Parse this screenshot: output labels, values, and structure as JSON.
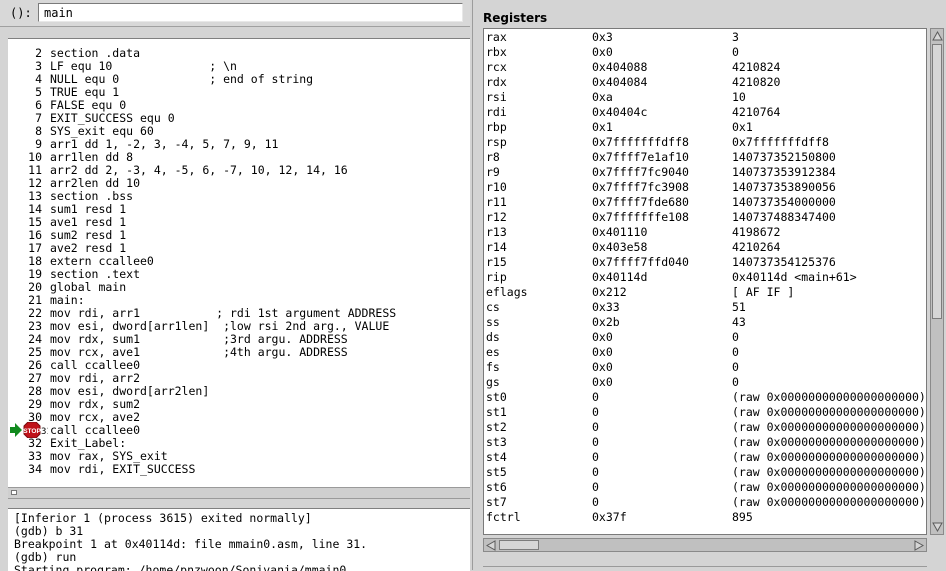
{
  "expression_bar": {
    "label": "():",
    "value": "main"
  },
  "source": {
    "breakpoint_marker": "STOP",
    "lines": [
      {
        "num": "2",
        "code": "section .data"
      },
      {
        "num": "3",
        "code": "LF equ 10              ; \\n"
      },
      {
        "num": "4",
        "code": "NULL equ 0             ; end of string"
      },
      {
        "num": "5",
        "code": "TRUE equ 1"
      },
      {
        "num": "6",
        "code": "FALSE equ 0"
      },
      {
        "num": "7",
        "code": "EXIT_SUCCESS equ 0"
      },
      {
        "num": "8",
        "code": "SYS_exit equ 60"
      },
      {
        "num": "9",
        "code": "arr1 dd 1, -2, 3, -4, 5, 7, 9, 11"
      },
      {
        "num": "10",
        "code": "arr1len dd 8"
      },
      {
        "num": "11",
        "code": "arr2 dd 2, -3, 4, -5, 6, -7, 10, 12, 14, 16"
      },
      {
        "num": "12",
        "code": "arr2len dd 10"
      },
      {
        "num": "13",
        "code": "section .bss"
      },
      {
        "num": "14",
        "code": "sum1 resd 1"
      },
      {
        "num": "15",
        "code": "ave1 resd 1"
      },
      {
        "num": "16",
        "code": "sum2 resd 1"
      },
      {
        "num": "17",
        "code": "ave2 resd 1"
      },
      {
        "num": "18",
        "code": "extern ccallee0"
      },
      {
        "num": "19",
        "code": "section .text"
      },
      {
        "num": "20",
        "code": "global main"
      },
      {
        "num": "21",
        "code": "main:"
      },
      {
        "num": "22",
        "code": "mov rdi, arr1           ; rdi 1st argument ADDRESS"
      },
      {
        "num": "23",
        "code": "mov esi, dword[arr1len]  ;low rsi 2nd arg., VALUE"
      },
      {
        "num": "24",
        "code": "mov rdx, sum1            ;3rd argu. ADDRESS"
      },
      {
        "num": "25",
        "code": "mov rcx, ave1            ;4th argu. ADDRESS"
      },
      {
        "num": "26",
        "code": "call ccallee0"
      },
      {
        "num": "27",
        "code": "mov rdi, arr2"
      },
      {
        "num": "28",
        "code": "mov esi, dword[arr2len]"
      },
      {
        "num": "29",
        "code": "mov rdx, sum2"
      },
      {
        "num": "30",
        "code": "mov rcx, ave2"
      },
      {
        "num": "31",
        "code": "call ccallee0"
      },
      {
        "num": "32",
        "code": "Exit_Label:"
      },
      {
        "num": "33",
        "code": "mov rax, SYS_exit"
      },
      {
        "num": "34",
        "code": "mov rdi, EXIT_SUCCESS"
      }
    ]
  },
  "console": {
    "lines": [
      "[Inferior 1 (process 3615) exited normally]",
      "(gdb) b 31",
      "Breakpoint 1 at 0x40114d: file mmain0.asm, line 31.",
      "(gdb) run",
      "Starting program: /home/pnzwoon/Sonivania/mmain0"
    ]
  },
  "registers": {
    "title": "Registers",
    "rows": [
      {
        "name": "rax",
        "hex": "0x3",
        "natural": "3"
      },
      {
        "name": "rbx",
        "hex": "0x0",
        "natural": "0"
      },
      {
        "name": "rcx",
        "hex": "0x404088",
        "natural": "4210824"
      },
      {
        "name": "rdx",
        "hex": "0x404084",
        "natural": "4210820"
      },
      {
        "name": "rsi",
        "hex": "0xa",
        "natural": "10"
      },
      {
        "name": "rdi",
        "hex": "0x40404c",
        "natural": "4210764"
      },
      {
        "name": "rbp",
        "hex": "0x1",
        "natural": "0x1"
      },
      {
        "name": "rsp",
        "hex": "0x7fffffffdff8",
        "natural": "0x7fffffffdff8"
      },
      {
        "name": "r8",
        "hex": "0x7ffff7e1af10",
        "natural": "140737352150800"
      },
      {
        "name": "r9",
        "hex": "0x7ffff7fc9040",
        "natural": "140737353912384"
      },
      {
        "name": "r10",
        "hex": "0x7ffff7fc3908",
        "natural": "140737353890056"
      },
      {
        "name": "r11",
        "hex": "0x7ffff7fde680",
        "natural": "140737354000000"
      },
      {
        "name": "r12",
        "hex": "0x7fffffffe108",
        "natural": "140737488347400"
      },
      {
        "name": "r13",
        "hex": "0x401110",
        "natural": "4198672"
      },
      {
        "name": "r14",
        "hex": "0x403e58",
        "natural": "4210264"
      },
      {
        "name": "r15",
        "hex": "0x7ffff7ffd040",
        "natural": "140737354125376"
      },
      {
        "name": "rip",
        "hex": "0x40114d",
        "natural": "0x40114d <main+61>"
      },
      {
        "name": "eflags",
        "hex": "0x212",
        "natural": "[ AF IF ]"
      },
      {
        "name": "cs",
        "hex": "0x33",
        "natural": "51"
      },
      {
        "name": "ss",
        "hex": "0x2b",
        "natural": "43"
      },
      {
        "name": "ds",
        "hex": "0x0",
        "natural": "0"
      },
      {
        "name": "es",
        "hex": "0x0",
        "natural": "0"
      },
      {
        "name": "fs",
        "hex": "0x0",
        "natural": "0"
      },
      {
        "name": "gs",
        "hex": "0x0",
        "natural": "0"
      },
      {
        "name": "st0",
        "hex": "0",
        "natural": "(raw 0x00000000000000000000)"
      },
      {
        "name": "st1",
        "hex": "0",
        "natural": "(raw 0x00000000000000000000)"
      },
      {
        "name": "st2",
        "hex": "0",
        "natural": "(raw 0x00000000000000000000)"
      },
      {
        "name": "st3",
        "hex": "0",
        "natural": "(raw 0x00000000000000000000)"
      },
      {
        "name": "st4",
        "hex": "0",
        "natural": "(raw 0x00000000000000000000)"
      },
      {
        "name": "st5",
        "hex": "0",
        "natural": "(raw 0x00000000000000000000)"
      },
      {
        "name": "st6",
        "hex": "0",
        "natural": "(raw 0x00000000000000000000)"
      },
      {
        "name": "st7",
        "hex": "0",
        "natural": "(raw 0x00000000000000000000)"
      },
      {
        "name": "fctrl",
        "hex": "0x37f",
        "natural": "895"
      }
    ]
  },
  "icons": {
    "breakpoint": "stop-sign-with-arrow-icon",
    "scroll_up": "triangle-up-icon",
    "scroll_down": "triangle-down-icon",
    "scroll_left": "triangle-left-icon",
    "scroll_right": "triangle-right-icon"
  },
  "colors": {
    "breakpoint_red": "#c0131a",
    "pc_arrow_green": "#118a1e"
  }
}
